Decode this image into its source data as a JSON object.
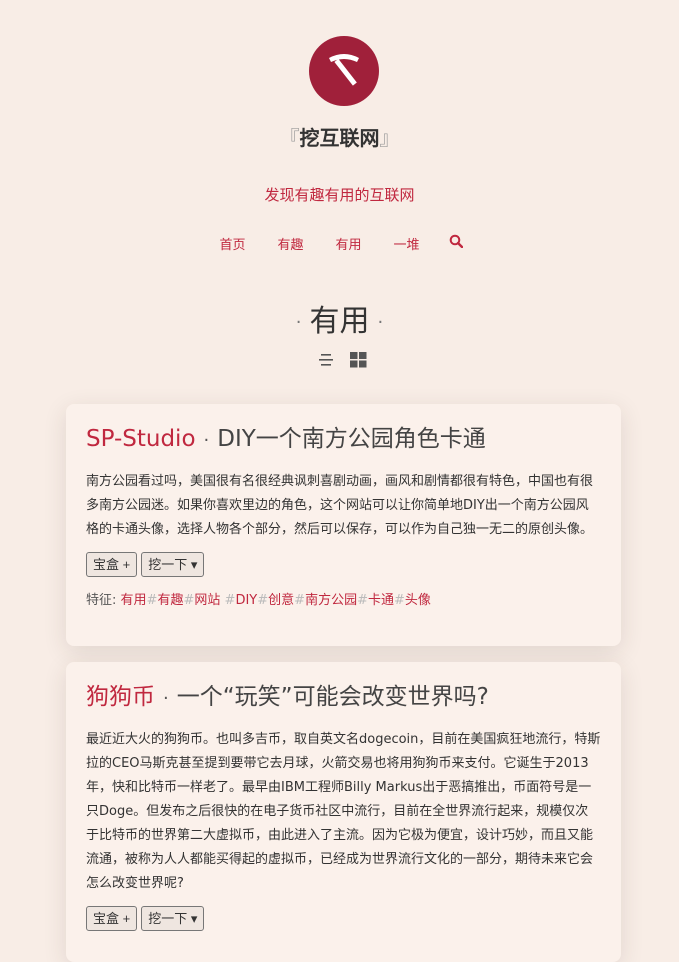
{
  "site": {
    "title": "挖互联网",
    "bracket_left": "『",
    "bracket_right": "』",
    "tagline": "发现有趣有用的互联网"
  },
  "nav": {
    "items": [
      "首页",
      "有趣",
      "有用",
      "一堆"
    ],
    "search_icon": "search-icon"
  },
  "page": {
    "heading": "有用",
    "dot": "·"
  },
  "view": {
    "list_icon": "list-view-icon",
    "grid_icon": "grid-view-icon"
  },
  "colors": {
    "accent": "#c0283f",
    "logo_bg": "#a0203a",
    "background": "#f8ede6",
    "card_bg": "#fbf1eb"
  },
  "cards": [
    {
      "name": "SP-Studio",
      "sep": "·",
      "subtitle": "DIY一个南方公园角色卡通",
      "description": "南方公园看过吗，美国很有名很经典讽刺喜剧动画，画风和剧情都很有特色，中国也有很多南方公园迷。如果你喜欢里边的角色，这个网站可以让你简单地DIY出一个南方公园风格的卡通头像，选择人物各个部分，然后可以保存，可以作为自己独一无二的原创头像。",
      "btn_box": "宝盒 +",
      "btn_dig": "挖一下",
      "tags_label": "特征:",
      "tags": [
        "有用",
        "有趣",
        "网站",
        "DIY",
        "创意",
        "南方公园",
        "卡通",
        "头像"
      ]
    },
    {
      "name": "狗狗币",
      "sep": "·",
      "subtitle": "一个“玩笑”可能会改变世界吗?",
      "description": "最近近大火的狗狗币。也叫多吉币，取自英文名dogecoin，目前在美国疯狂地流行，特斯拉的CEO马斯克甚至提到要带它去月球，火箭交易也将用狗狗币来支付。它诞生于2013年，快和比特币一样老了。最早由IBM工程师Billy Markus出于恶搞推出，币面符号是一只Doge。但发布之后很快的在电子货币社区中流行，目前在全世界流行起来，规模仅次于比特币的世界第二大虚拟币，由此进入了主流。因为它极为便宜，设计巧妙，而且又能流通，被称为人人都能买得起的虚拟币，已经成为世界流行文化的一部分，期待未来它会怎么改变世界呢?",
      "btn_box": "宝盒 +",
      "btn_dig": "挖一下"
    }
  ]
}
